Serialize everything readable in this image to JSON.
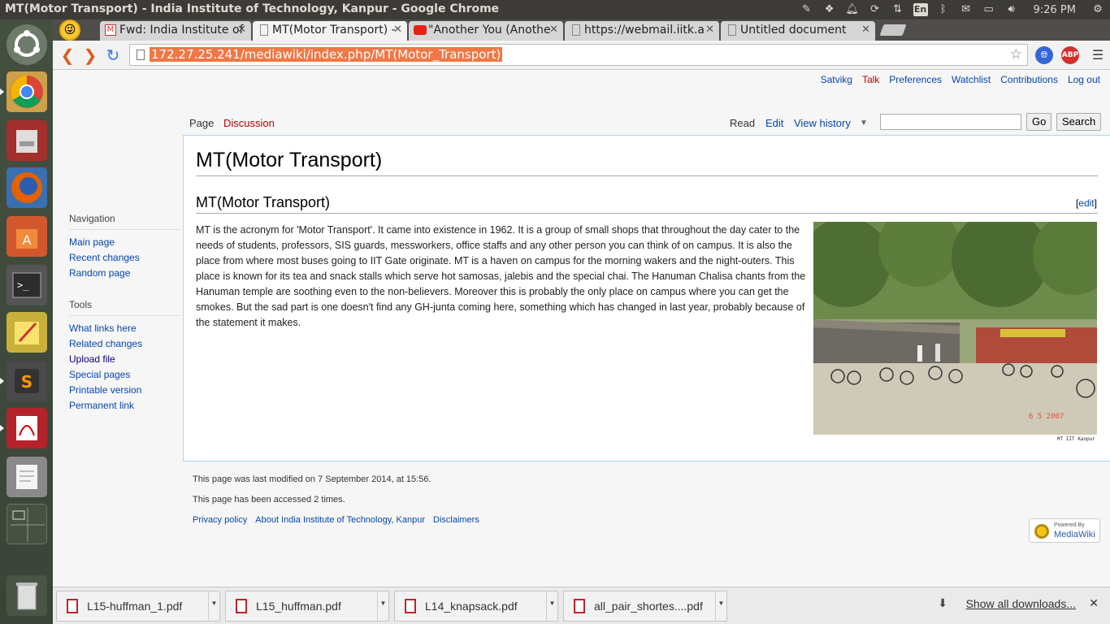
{
  "system": {
    "window_title": "MT(Motor Transport) - India Institute of Technology, Kanpur - Google Chrome",
    "clock": "9:26 PM",
    "keyboard": "En"
  },
  "tabs": [
    {
      "title": "Fwd: India Institute of",
      "icon": "gmail-icon"
    },
    {
      "title": "MT(Motor Transport) -",
      "icon": "page-icon",
      "active": true
    },
    {
      "title": "\"Another You (Anothe",
      "icon": "youtube-icon"
    },
    {
      "title": "https://webmail.iitk.a",
      "icon": "page-icon"
    },
    {
      "title": "Untitled document",
      "icon": "page-icon"
    }
  ],
  "address_bar": {
    "url": "172.27.25.241/mediawiki/index.php/MT(Motor_Transport)"
  },
  "personal_tools": {
    "user": "Satvikg",
    "talk": "Talk",
    "preferences": "Preferences",
    "watchlist": "Watchlist",
    "contributions": "Contributions",
    "logout": "Log out"
  },
  "page_tabs": {
    "page": "Page",
    "discussion": "Discussion",
    "read": "Read",
    "edit": "Edit",
    "view_history": "View history"
  },
  "search": {
    "go": "Go",
    "search": "Search",
    "value": ""
  },
  "sidebar": {
    "navigation_heading": "Navigation",
    "navigation": [
      "Main page",
      "Recent changes",
      "Random page"
    ],
    "tools_heading": "Tools",
    "tools": [
      "What links here",
      "Related changes",
      "Upload file",
      "Special pages",
      "Printable version",
      "Permanent link"
    ]
  },
  "article": {
    "title": "MT(Motor Transport)",
    "section_heading": "MT(Motor Transport)",
    "edit_open": "[",
    "edit_label": "edit",
    "edit_close": "]",
    "body": "MT is the acronym for 'Motor Transport'. It came into existence in 1962. It is a group of small shops that throughout the day cater to the needs of students, professors, SIS guards, messworkers, office staffs and any other person you can think of on campus. It is also the place from where most buses going to IIT Gate originate. MT is a haven on campus for the morning wakers and the night-outers. This place is known for its tea and snack stalls which serve hot samosas, jalebis and the special chai. The Hanuman Chalisa chants from the Hanuman temple are soothing even to the non-believers. Moreover this is probably the only place on campus where you can get the smokes. But the sad part is one doesn't find any GH-junta coming here, something which has changed in last year, probably because of the statement it makes.",
    "photo_date_stamp": "6 5 2007",
    "photo_caption": "MT IIT Kanpur"
  },
  "footer": {
    "last_modified": "This page was last modified on 7 September 2014, at 15:56.",
    "accessed": "This page has been accessed 2 times.",
    "privacy": "Privacy policy",
    "about": "About India Institute of Technology, Kanpur",
    "disclaimers": "Disclaimers",
    "badge_line1": "Powered By",
    "badge_line2": "MediaWiki"
  },
  "downloads": {
    "items": [
      "L15-huffman_1.pdf",
      "L15_huffman.pdf",
      "L14_knapsack.pdf",
      "all_pair_shortes....pdf"
    ],
    "show_all": "Show all downloads..."
  },
  "colors": {
    "link": "#0645ad",
    "redlink": "#ba0000",
    "url_highlight": "#f07746",
    "topbar": "#3c3b37"
  }
}
